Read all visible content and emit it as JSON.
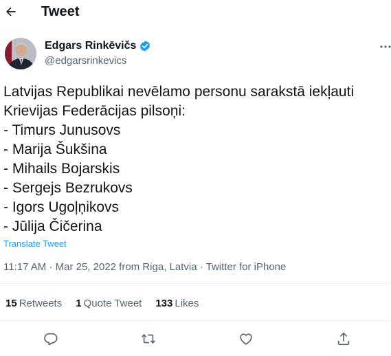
{
  "header": {
    "title": "Tweet",
    "back_icon": "arrow-left-icon"
  },
  "author": {
    "name": "Edgars Rinkēvičs",
    "handle": "@edgarsrinkevics",
    "verified": true,
    "verified_color": "#1d9bf0"
  },
  "tweet": {
    "text": "Latvijas Republikai nevēlamo personu sarakstā iekļauti\nKrievijas Federācijas pilsoņi:\n- Timurs Junusovs\n- Marija Šukšina\n- Mihails Bojarskis\n- Sergejs Bezrukovs\n- Igors Ugoļņikovs\n- Jūlija Čičerina",
    "translate_label": "Translate Tweet",
    "time": "11:17 AM",
    "date": "Mar 25, 2022",
    "location": "from Riga, Latvia",
    "source": "Twitter for iPhone"
  },
  "stats": {
    "retweets_count": "15",
    "retweets_label": "Retweets",
    "quotes_count": "1",
    "quotes_label": "Quote Tweet",
    "likes_count": "133",
    "likes_label": "Likes"
  },
  "actions": [
    "reply-icon",
    "retweet-icon",
    "like-icon",
    "share-icon"
  ],
  "colors": {
    "text": "#0f1419",
    "secondary": "#536471",
    "accent": "#1d9bf0"
  }
}
